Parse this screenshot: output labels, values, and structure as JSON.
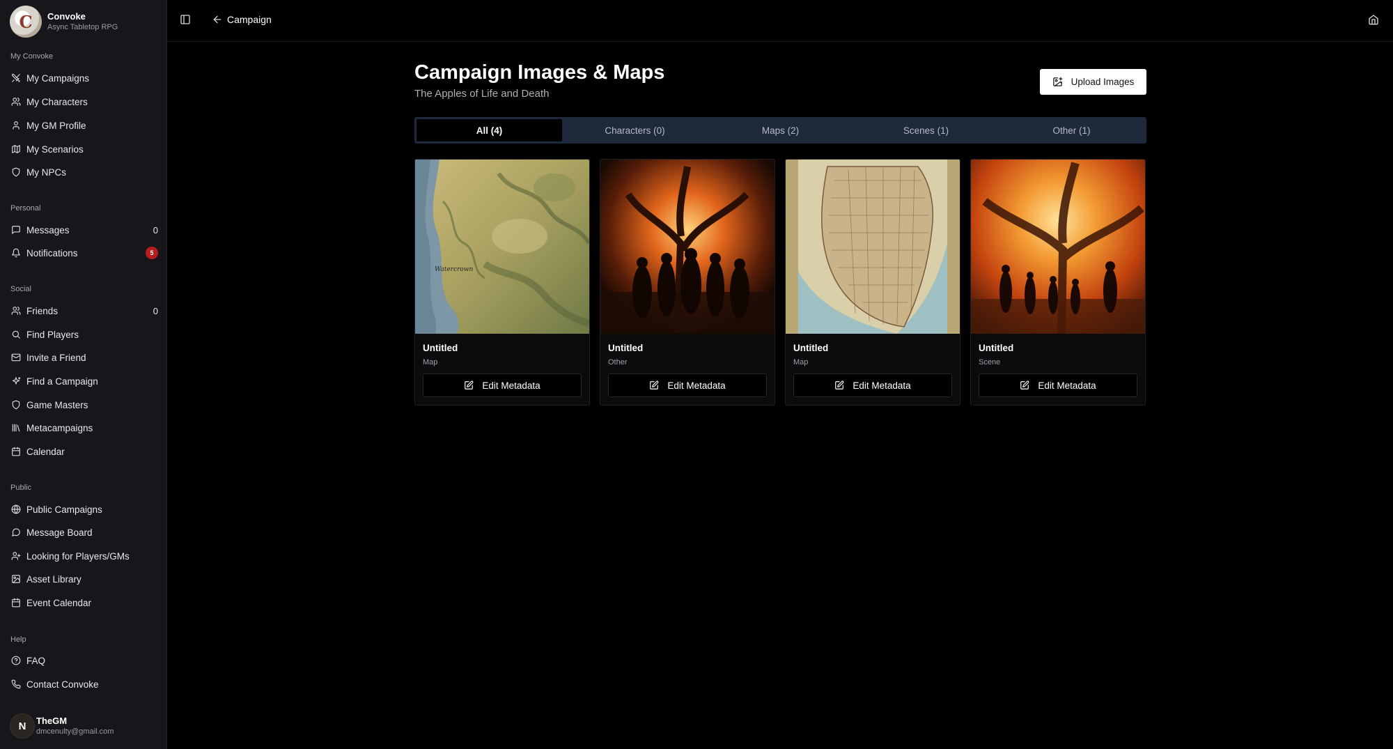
{
  "brand": {
    "name": "Convoke",
    "subtitle": "Async Tabletop RPG",
    "logo_letter": "C"
  },
  "sidebar": {
    "sections": {
      "my_convoke": "My Convoke",
      "personal": "Personal",
      "social": "Social",
      "public": "Public",
      "help": "Help"
    },
    "my_convoke": [
      {
        "label": "My Campaigns",
        "icon": "swords-icon"
      },
      {
        "label": "My Characters",
        "icon": "users-icon"
      },
      {
        "label": "My GM Profile",
        "icon": "user-icon"
      },
      {
        "label": "My Scenarios",
        "icon": "map-icon"
      },
      {
        "label": "My NPCs",
        "icon": "shield-icon"
      }
    ],
    "personal": [
      {
        "label": "Messages",
        "icon": "message-icon",
        "count": "0"
      },
      {
        "label": "Notifications",
        "icon": "bell-icon",
        "badge": "5"
      }
    ],
    "social": [
      {
        "label": "Friends",
        "icon": "users-icon",
        "count": "0"
      },
      {
        "label": "Find Players",
        "icon": "search-icon"
      },
      {
        "label": "Invite a Friend",
        "icon": "mail-icon"
      },
      {
        "label": "Find a Campaign",
        "icon": "sparkles-icon"
      },
      {
        "label": "Game Masters",
        "icon": "shield-icon"
      },
      {
        "label": "Metacampaigns",
        "icon": "library-icon"
      },
      {
        "label": "Calendar",
        "icon": "calendar-icon"
      }
    ],
    "public": [
      {
        "label": "Public Campaigns",
        "icon": "globe-icon"
      },
      {
        "label": "Message Board",
        "icon": "message-circle-icon"
      },
      {
        "label": "Looking for Players/GMs",
        "icon": "user-plus-icon"
      },
      {
        "label": "Asset Library",
        "icon": "image-icon"
      },
      {
        "label": "Event Calendar",
        "icon": "calendar-icon"
      }
    ],
    "help": [
      {
        "label": "FAQ",
        "icon": "help-circle-icon"
      },
      {
        "label": "Contact Convoke",
        "icon": "phone-icon"
      }
    ]
  },
  "user": {
    "name": "TheGM",
    "email": "dmcenulty@gmail.com",
    "avatar_letter": "N"
  },
  "topbar": {
    "back_label": "Campaign"
  },
  "page": {
    "title": "Campaign Images & Maps",
    "subtitle": "The Apples of Life and Death",
    "upload_label": "Upload Images"
  },
  "tabs": [
    {
      "label": "All (4)",
      "active": true
    },
    {
      "label": "Characters (0)",
      "active": false
    },
    {
      "label": "Maps (2)",
      "active": false
    },
    {
      "label": "Scenes (1)",
      "active": false
    },
    {
      "label": "Other (1)",
      "active": false
    }
  ],
  "cards": [
    {
      "title": "Untitled",
      "type": "Map",
      "edit_label": "Edit Metadata"
    },
    {
      "title": "Untitled",
      "type": "Other",
      "edit_label": "Edit Metadata"
    },
    {
      "title": "Untitled",
      "type": "Map",
      "edit_label": "Edit Metadata"
    },
    {
      "title": "Untitled",
      "type": "Scene",
      "edit_label": "Edit Metadata"
    }
  ],
  "map_label": "Watercrown",
  "colors": {
    "tab_bar": "#1e293b",
    "badge": "#b91c1c",
    "sidebar": "#17171b"
  }
}
